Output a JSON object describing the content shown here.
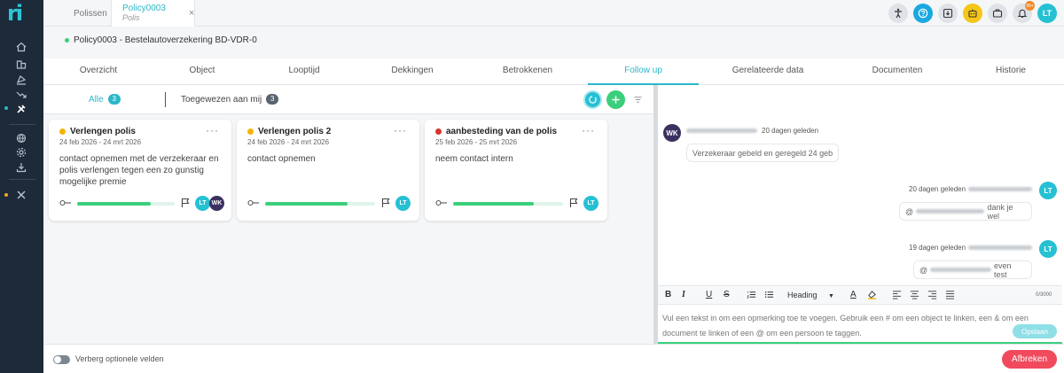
{
  "app": {
    "logo": "ri"
  },
  "top_tabs": [
    {
      "label": "Polissen"
    },
    {
      "label": "Policy0003",
      "sublabel": "Polis",
      "close": "×"
    }
  ],
  "top_icons": [
    {
      "icon": "accessibility-icon",
      "color": "#dfe3e8"
    },
    {
      "icon": "help-icon",
      "color": "#1ba8e0"
    },
    {
      "icon": "download-icon",
      "color": "#dfe3e8"
    },
    {
      "icon": "robot-icon",
      "color": "#f5c518"
    },
    {
      "icon": "briefcase-icon",
      "color": "#dfe3e8"
    },
    {
      "icon": "bell-icon",
      "color": "#dfe3e8",
      "badge": "99+"
    },
    {
      "icon": "user-avatar",
      "label": "LT",
      "color": "#26c0d3"
    }
  ],
  "header": {
    "title": "Policy0003 - Bestelautoverzekering  BD-VDR-0"
  },
  "tabs": [
    {
      "label": "Overzicht"
    },
    {
      "label": "Object"
    },
    {
      "label": "Looptijd"
    },
    {
      "label": "Dekkingen"
    },
    {
      "label": "Betrokkenen"
    },
    {
      "label": "Follow up",
      "active": true
    },
    {
      "label": "Gerelateerde data"
    },
    {
      "label": "Documenten"
    },
    {
      "label": "Historie"
    }
  ],
  "subtabs": [
    {
      "label": "Alle",
      "count": "3",
      "active": true
    },
    {
      "label": "Toegewezen aan mij",
      "count": "3"
    }
  ],
  "cards": [
    {
      "title": "Verlengen polis",
      "status_color": "#f5b400",
      "date": "24 feb 2026 - 24 mrt 2026",
      "menu": "···",
      "description": "contact opnemen met de verzekeraar en polis verlengen tegen een zo gunstig mogelijke premie",
      "progress": 0.75,
      "assignees": [
        {
          "label": "LT",
          "color": "#26c0d3"
        },
        {
          "label": "WK",
          "color": "#3b3160"
        }
      ]
    },
    {
      "title": "Verlengen polis 2",
      "status_color": "#f5b400",
      "date": "24 feb 2026 - 24 mrt 2026",
      "menu": "···",
      "description": "contact opnemen",
      "progress": 0.75,
      "assignees": [
        {
          "label": "LT",
          "color": "#26c0d3"
        }
      ]
    },
    {
      "title": "aanbesteding van de polis",
      "status_color": "#d9342b",
      "date": "25 feb 2026 - 25 mrt 2026",
      "menu": "···",
      "description": "neem contact intern",
      "progress": 0.73,
      "assignees": [
        {
          "label": "LT",
          "color": "#26c0d3"
        }
      ]
    }
  ],
  "messages": [
    {
      "avatar": "WK",
      "avatar_color": "#3b3160",
      "time": "20 dagen geleden",
      "text": "Verzekeraar gebeld en geregeld 24 geb",
      "side": "left"
    },
    {
      "avatar": "LT",
      "avatar_color": "#26c0d3",
      "time": "20 dagen geleden",
      "text": "dank je wel",
      "mention": "@",
      "side": "right"
    },
    {
      "avatar": "LT",
      "avatar_color": "#26c0d3",
      "time": "19 dagen geleden",
      "text": "even test",
      "mention": "@",
      "side": "right"
    }
  ],
  "editor": {
    "heading_label": "Heading",
    "char_count": "0/3000",
    "placeholder": "Vul een tekst in om een opmerking toe te voegen. Gebruik een # om een object te linken, een & om een document te linken of een @ om een persoon te taggen.",
    "save_label": "Opslaan"
  },
  "footer": {
    "toggle_label": "Verberg optionele velden",
    "cancel_label": "Afbreken"
  },
  "colors": {
    "accent": "#2cb7c9",
    "green": "#3bcf7b",
    "sidebar": "#1c2a3a",
    "danger": "#f04a5c"
  }
}
